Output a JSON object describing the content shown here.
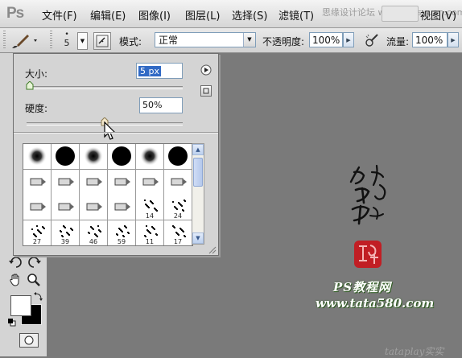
{
  "app": {
    "logo": "Ps"
  },
  "menu": {
    "items": [
      "文件(F)",
      "编辑(E)",
      "图像(I)",
      "图层(L)",
      "选择(S)",
      "滤镜(T)",
      "思缘设计论坛 www.missyuan.com",
      "视图(V)"
    ]
  },
  "options_bar": {
    "brush_size": "5",
    "mode_label": "模式:",
    "mode_value": "正常",
    "opacity_label": "不透明度:",
    "opacity_value": "100%",
    "flow_label": "流量:",
    "flow_value": "100%"
  },
  "brush_popup": {
    "size_label": "大小:",
    "size_value": "5 px",
    "size_level": 0.01,
    "hardness_label": "硬度:",
    "hardness_value": "50%",
    "hardness_level": 0.5,
    "preset_labels": [
      "",
      "",
      "",
      "",
      "",
      "",
      "",
      "",
      "",
      "",
      "",
      "",
      "",
      "",
      "",
      "",
      "14",
      "24",
      "27",
      "39",
      "46",
      "59",
      "11",
      "17"
    ]
  },
  "watermark": {
    "site_cn": "PS教程网",
    "site_url": "www.tata580.com",
    "corner": "tataplay实实"
  }
}
